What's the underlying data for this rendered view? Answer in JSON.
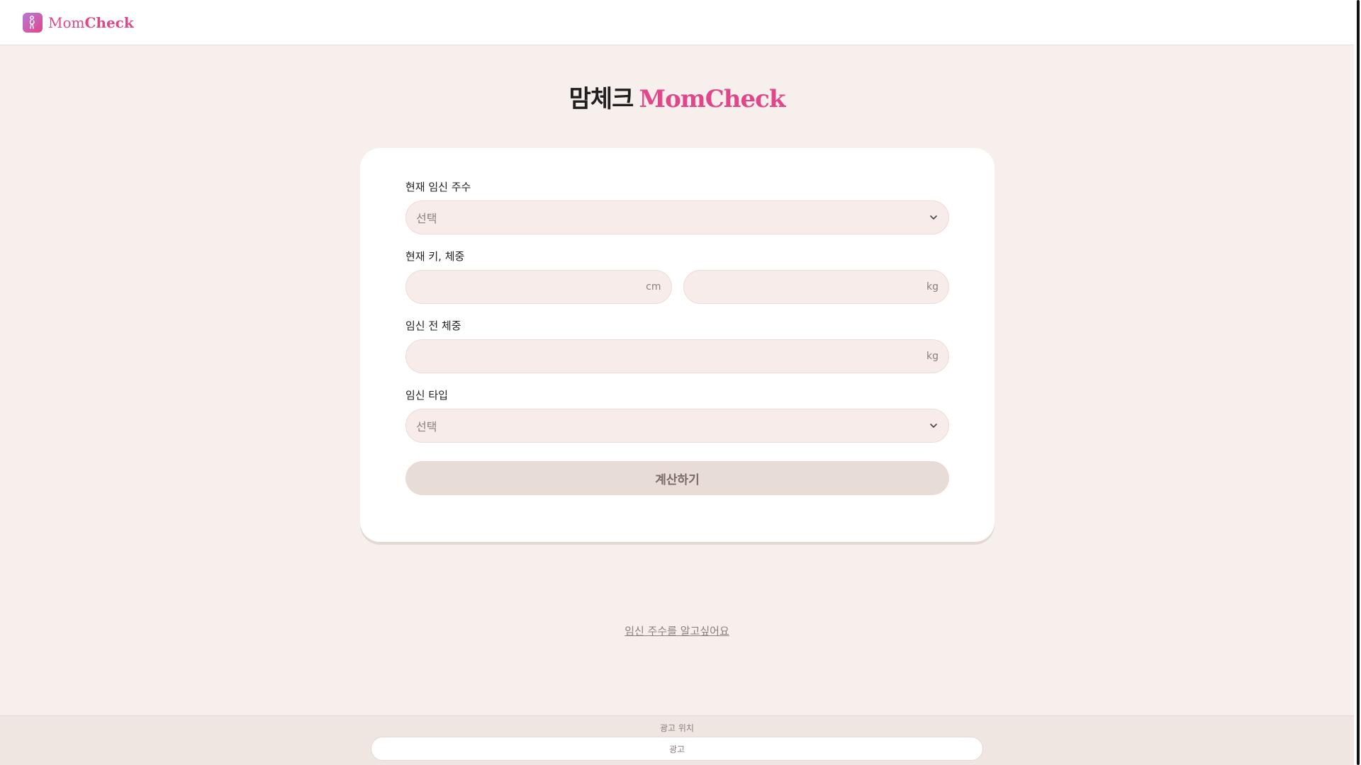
{
  "brand": {
    "name_light": "Mom",
    "name_bold": "Check",
    "accent": "#e0468a"
  },
  "title": {
    "korean": "맘체크",
    "english": "MomCheck"
  },
  "form": {
    "gestational_week": {
      "label": "현재 임신 주수",
      "placeholder": "선택"
    },
    "height_weight": {
      "label": "현재 키, 체중",
      "height_unit": "cm",
      "weight_unit": "kg"
    },
    "pre_pregnancy_weight": {
      "label": "임신 전 체중",
      "unit": "kg"
    },
    "pregnancy_type": {
      "label": "임신 타입",
      "placeholder": "선택"
    },
    "submit_label": "계산하기"
  },
  "help_link": "임신 주수를 알고싶어요",
  "ad": {
    "label": "광고 위치",
    "box_text": "광고"
  }
}
